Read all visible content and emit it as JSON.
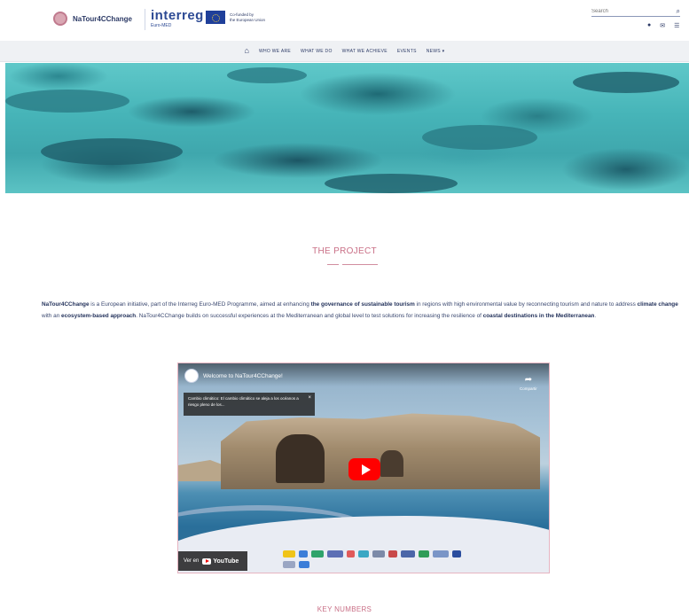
{
  "header": {
    "project_logo_text": "NaTour4CChange",
    "interreg_logo_text": "interreg",
    "interreg_sub": "Euro-MED",
    "eu_caption_line1": "Co-funded by",
    "eu_caption_line2": "the European Union",
    "search_placeholder": "Search"
  },
  "nav": {
    "items": [
      "WHO WE ARE",
      "WHAT WE DO",
      "WHAT WE ACHIEVE",
      "EVENTS",
      "NEWS"
    ]
  },
  "project": {
    "title": "THE PROJECT",
    "p_brand": "NaTour4CChange",
    "p_1": " is a European initiative, part of the Interreg Euro-MED Programme, aimed at enhancing ",
    "p_b1": "the governance of sustainable tourism",
    "p_2": " in regions with high environmental value by reconnecting tourism and nature to address ",
    "p_b2": "climate change",
    "p_3": " with an ",
    "p_b3": "ecosystem-based approach",
    "p_4": ". NaTour4CChange builds on successful experiences at the Mediterranean and global level to test solutions for increasing the resilience of ",
    "p_b4": "coastal destinations in the Mediterranean",
    "p_5": "."
  },
  "video": {
    "title": "Welcome to NaTour4CChange!",
    "share_label": "Compartir",
    "card_text": "Cambio climático: El cambio climático se aleja a los océanos a riesgo pleno de los...",
    "watch_on": "Ver en",
    "youtube": "YouTube"
  },
  "key_numbers": {
    "title": "KEY NUMBERS"
  },
  "colors": {
    "accent_pink": "#c96f86",
    "navy": "#2c3a66"
  }
}
